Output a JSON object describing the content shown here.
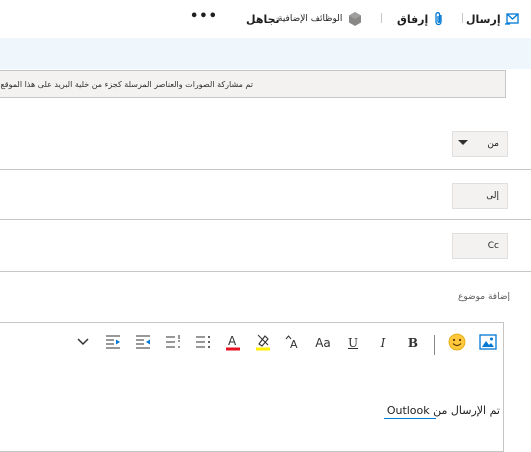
{
  "toolbar": {
    "send_label": "إرسال",
    "attach_label": "إرفاق",
    "addins_label": "الوظائف الإضافية",
    "discard_label": "تجاهل",
    "more_label": "•••"
  },
  "info_bar": {
    "text": "تم مشاركة الصورات والعناصر المرسلة كجزء من خلية البريد على هذا الموقع."
  },
  "fields": {
    "from_label": "من",
    "to_label": "إلى",
    "cc_label": "Cc",
    "subject_placeholder": "إضافة موضوع"
  },
  "format_toolbar": {
    "bold": "B",
    "italic": "I",
    "underline": "U",
    "font_size": "Aa",
    "font_grow": "A"
  },
  "body": {
    "signature": "تم الإرسال من Outlook"
  },
  "colors": {
    "accent": "#0078d4",
    "font_color": "#e81123",
    "highlight": "#fff100"
  }
}
